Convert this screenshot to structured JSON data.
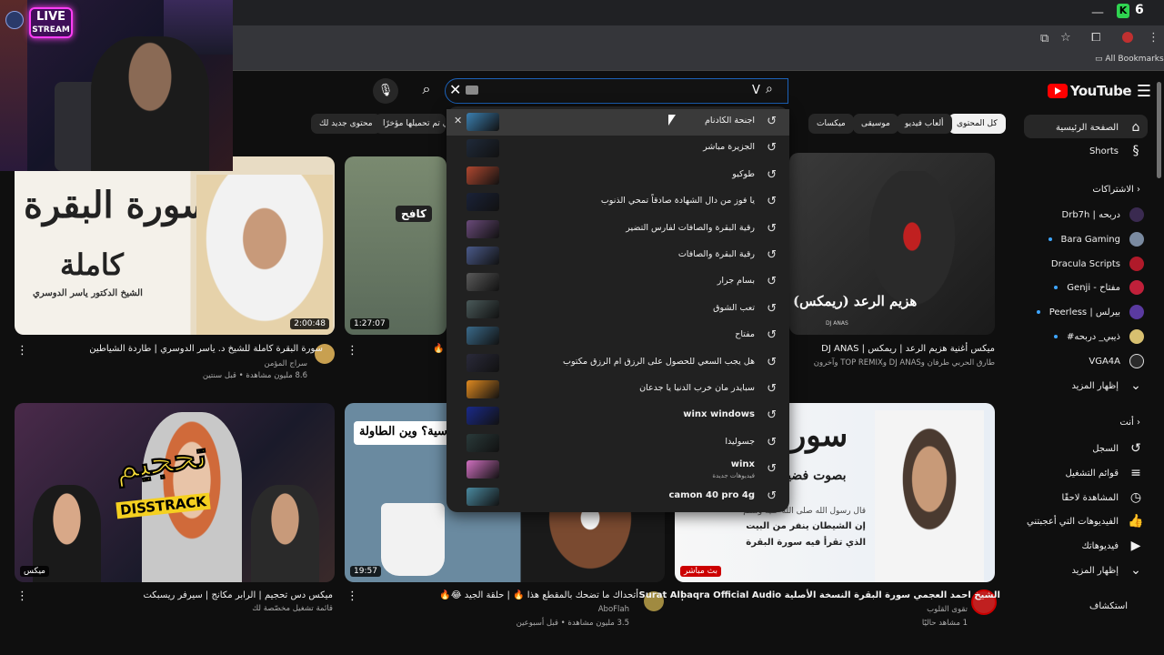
{
  "browser": {
    "bookmarks_label": "All Bookmarks",
    "ext_badge": "6"
  },
  "overlay": {
    "live_line1": "LIVE",
    "live_line2": "STREAM"
  },
  "header": {
    "logo_text": "YouTube",
    "search_caret": "V"
  },
  "chips": [
    {
      "label": "كل المحتوى",
      "active": true
    },
    {
      "label": "ألعاب فيديو"
    },
    {
      "label": "موسيقى"
    },
    {
      "label": "ميكسات"
    },
    {
      "label": "محتوى جديد لك"
    },
    {
      "label": "الفيديوهات التي تم تحميلها مؤخرًا"
    }
  ],
  "sidebar": {
    "home": "الصفحة الرئيسية",
    "shorts": "Shorts",
    "subscriptions_head": "الاشتراكات",
    "subscriptions": [
      {
        "label": "Drb7h | دربحه",
        "color": "#3a2a50"
      },
      {
        "label": "Bara Gaming",
        "color": "#7a8aa0"
      },
      {
        "label": "Dracula Scripts",
        "color": "#b01a2a"
      },
      {
        "label": "Genji - مفتاح",
        "color": "#c0203a"
      },
      {
        "label": "Peerless | بيرلس",
        "color": "#5a3aa0"
      },
      {
        "label": "#ذيبي_ دربحه",
        "color": "#d8c070"
      },
      {
        "label": "VGA4A",
        "color": "#2a2a2a"
      },
      {
        "label": "إظهار المزيد"
      }
    ],
    "you_head": "أنت",
    "you_items": [
      "السجل",
      "قوائم التشغيل",
      "المشاهدة لاحقًا",
      "الفيديوهات التي أعجبتني",
      "فيديوهاتك",
      "إظهار المزيد"
    ],
    "explore_head": "استكشاف"
  },
  "suggestions": [
    {
      "text": "اجنحة الكادنام",
      "thumb": "#3b7fb0",
      "highlighted": true
    },
    {
      "text": "الجزيرة مباشر",
      "thumb": "#1f2a3a"
    },
    {
      "text": "طوكيو",
      "thumb": "#b04830"
    },
    {
      "text": "يا فوز من دال الشهادة صادقاً تمحي الذنوب",
      "thumb": "#1a2238"
    },
    {
      "text": "رقية البقرة والصافات لفارس التضير",
      "thumb": "#6a4a7a"
    },
    {
      "text": "رقية البقرة والصافات",
      "thumb": "#4a5a8a"
    },
    {
      "text": "بسام جرار",
      "thumb": "#5a5a5a"
    },
    {
      "text": "تعب الشوق",
      "thumb": "#4a5a5a"
    },
    {
      "text": "مفتاح",
      "thumb": "#3a6a8a"
    },
    {
      "text": "هل يجب السعي للحصول على الرزق ام الرزق مكتوب",
      "thumb": "#2a2a3a"
    },
    {
      "text": "سبايدر مان خرب الدنيا يا جدعان",
      "thumb": "#e08a20"
    },
    {
      "text": "winx windows",
      "thumb": "#1a2a8a",
      "bold": true
    },
    {
      "text": "جسوليدا",
      "thumb": "#2a3a3a"
    },
    {
      "text": "winx",
      "sub": "فيديوهات جديدة",
      "thumb": "#d070c0",
      "bold": true
    },
    {
      "text": "camon 40 pro 4g",
      "thumb": "#4a8aa0",
      "bold": true
    }
  ],
  "videos": [
    {
      "title": "سورة البقرة كاملة للشيخ د. ياسر الدوسري | طاردة الشياطين",
      "channel": "سراج المؤمن",
      "meta": "8.6 مليون مشاهدة • قبل سنتين",
      "duration": "2:00:48",
      "thumb_text1": "سورة البقرة",
      "thumb_text2": "كاملة",
      "thumb_text3": "الشيخ الدكتور ياسر الدوسري"
    },
    {
      "title": "",
      "duration": "1:27:07",
      "thumb_text1": "كافح"
    },
    {
      "title": "ميكس أغنية هزيم الرعد | ريمكس | DJ ANAS",
      "channel": "طارق الحربي طرفان وDJ ANAS وTOP REMIX وآخرون",
      "thumb_text1": "هزيم الرعد (ريمكس)",
      "thumb_text2": "DJ ANAS"
    },
    {
      "title": "ميكس دس تحجيم | الرابر مكانج | سيرفر ريسبكت",
      "channel": "قائمة تشغيل مخصّصة لك",
      "badge": "ميكس",
      "thumb_text1": "تحجيم",
      "thumb_text2": "DISSTRACK"
    },
    {
      "title": "أتحداك ما تضحك بالمقطع هذا 🔥 | حلقة الجيد 😂🔥",
      "channel": "AboFlah",
      "meta": "3.5 مليون مشاهدة • قبل أسبوعين",
      "duration": "19:57",
      "thumb_text1": "هندسية؟ وين الطاولة"
    },
    {
      "title": "الشيخ احمد العجمي سورة البقرة النسخة الأصلية Surat Albaqra Official Audio",
      "channel": "تقوى القلوب",
      "meta": "1 مشاهد حاليًا",
      "badge": "بث مباشر",
      "thumb_text1": "سورة",
      "thumb_text2": "بصوت فضيلة",
      "thumb_text3": "قال رسول الله صلى الله عليه وسلم",
      "thumb_text4": "إن الشيطان ينفر من البيت",
      "thumb_text5": "الذي تقرأ فيه سورة البقرة"
    }
  ],
  "colors": {
    "accent": "#ff0000",
    "search_border": "#1c62b9",
    "live_badge": "#cc0000"
  }
}
